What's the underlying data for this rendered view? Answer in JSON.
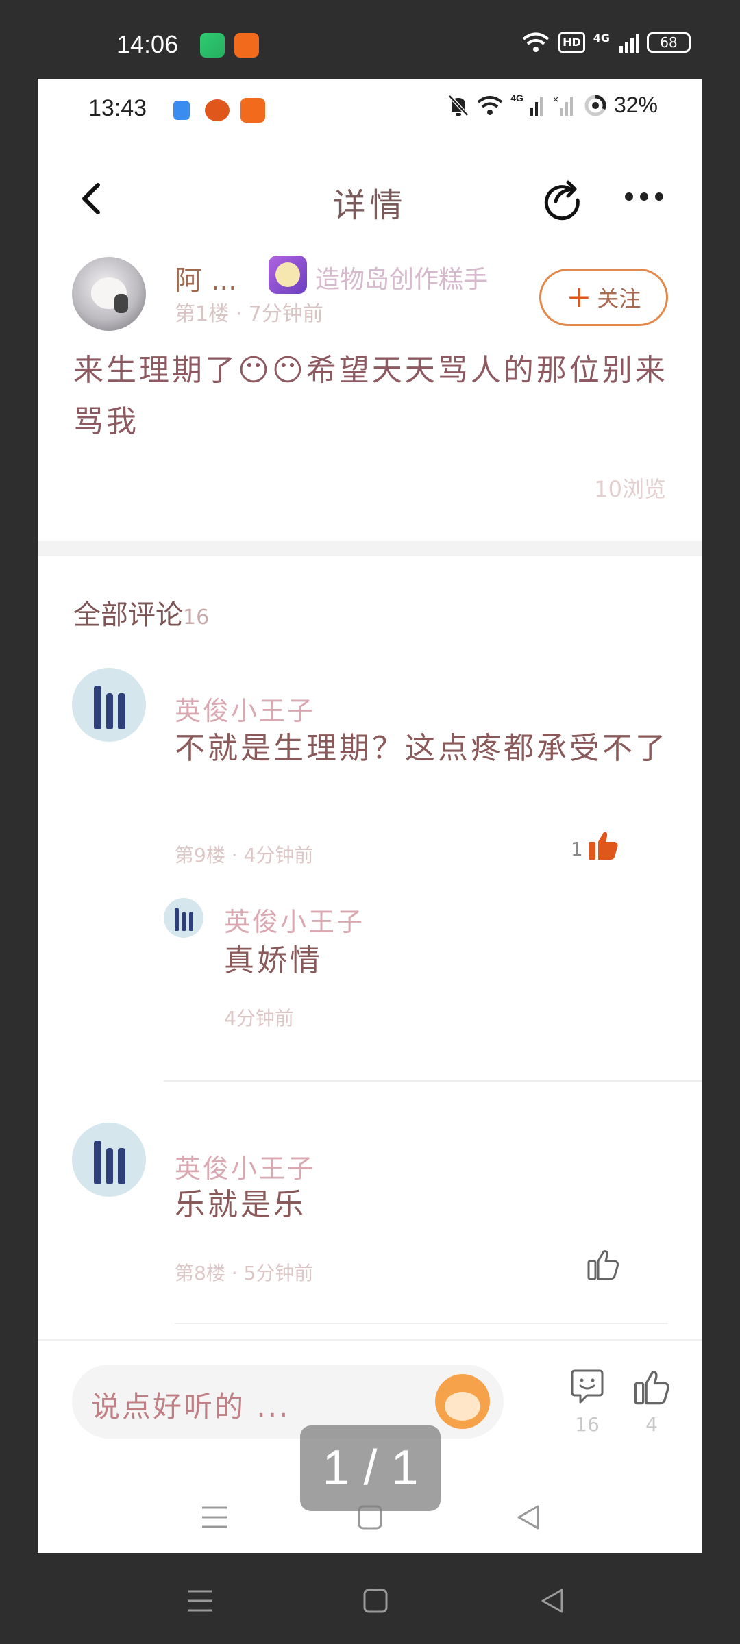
{
  "outer_status": {
    "time": "14:06",
    "hd": "HD",
    "network": "4G",
    "battery": "68"
  },
  "inner_status": {
    "time": "13:43",
    "network": "4G",
    "battery": "32%"
  },
  "nav": {
    "title": "详情"
  },
  "post": {
    "author": "阿 ...",
    "badge": "造物岛创作糕手",
    "meta": "第1楼 · 7分钟前",
    "follow_label": "关注",
    "content": "来生理期了😶😶希望天天骂人的那位别来骂我",
    "views": "10浏览"
  },
  "comments_section": {
    "title": "全部评论",
    "count": "16"
  },
  "comments": [
    {
      "name": "英俊小王子",
      "text": "不就是生理期？这点疼都承受不了",
      "meta": "第9楼 · 4分钟前",
      "likes": "1",
      "liked": true,
      "reply": {
        "name": "英俊小王子",
        "text": "真娇情",
        "meta": "4分钟前"
      }
    },
    {
      "name": "英俊小王子",
      "text": "乐就是乐",
      "meta": "第8楼 · 5分钟前",
      "likes": "",
      "liked": false
    }
  ],
  "input_bar": {
    "placeholder": "说点好听的 ...",
    "comment_count": "16",
    "like_count": "4"
  },
  "page_indicator": "1 / 1",
  "colors": {
    "accent": "#e0571b",
    "follow_border": "#e4874a",
    "text_brown": "#8a5a5a"
  },
  "icons": [
    "back-icon",
    "share-icon",
    "more-icon",
    "plus-icon",
    "thumb-up-icon",
    "comment-icon",
    "emoji-icon"
  ]
}
